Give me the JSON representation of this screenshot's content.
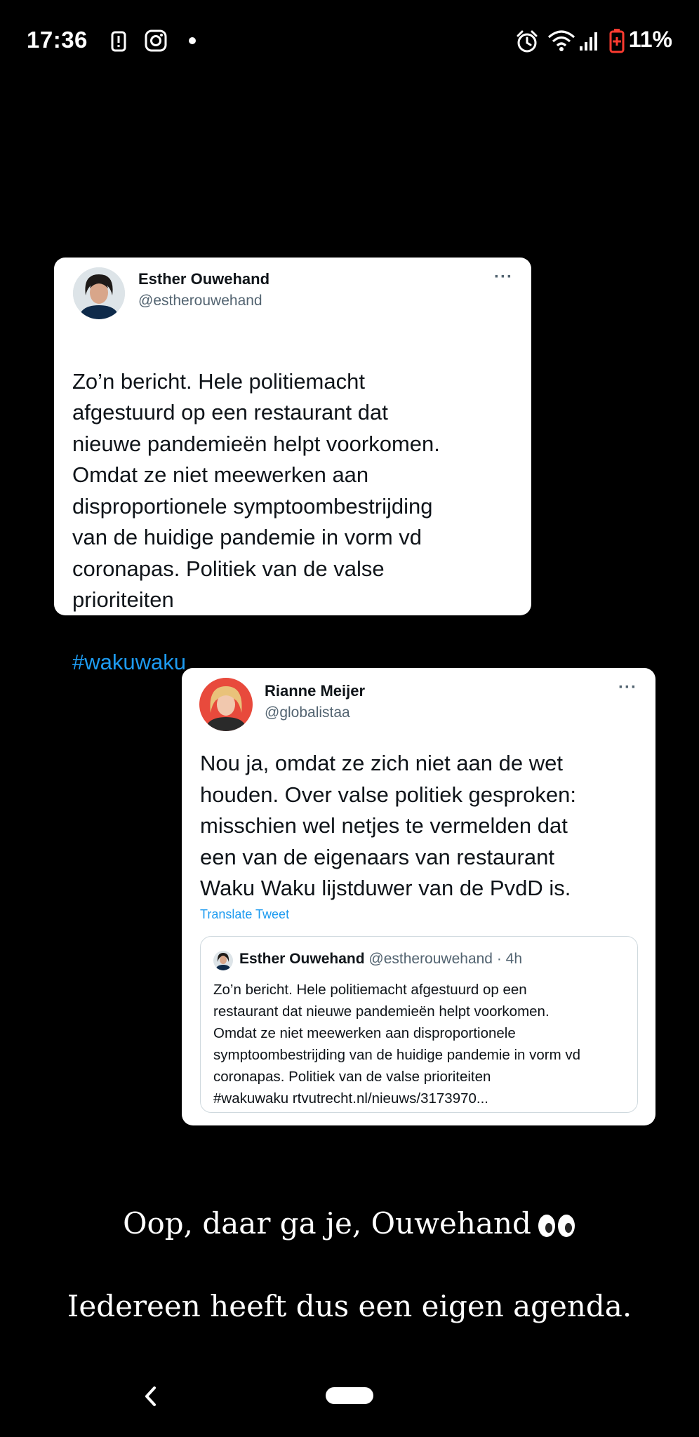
{
  "status_bar": {
    "time": "17:36",
    "battery": "11%",
    "icons": [
      "alert-icon",
      "instagram-icon",
      "dot-icon",
      "alarm-icon",
      "wifi-icon",
      "signal-icon",
      "battery-icon"
    ]
  },
  "tweet1": {
    "name": "Esther Ouwehand",
    "handle": "@estherouwehand",
    "more": "···",
    "text": "Zo’n bericht. Hele politiemacht\nafgestuurd op een restaurant dat\nnieuwe pandemieën helpt voorkomen.\nOmdat ze niet meewerken aan\ndisproportionele symptoombestrijding\nvan de huidige pandemie in vorm vd\ncoronapas. Politiek van de valse\nprioriteiten",
    "hashtag": "#wakuwaku"
  },
  "tweet2": {
    "name": "Rianne Meijer",
    "handle": "@globalistaa",
    "more": "···",
    "text": "Nou ja, omdat ze zich niet aan de wet\nhouden. Over valse politiek gesproken:\nmisschien wel netjes te vermelden dat\neen van de eigenaars van restaurant\nWaku Waku lijstduwer van de PvdD is.",
    "translate": "Translate Tweet",
    "quote": {
      "name": "Esther Ouwehand",
      "meta": "@estherouwehand · 4h",
      "text": "Zo’n bericht. Hele politiemacht afgestuurd op een\nrestaurant dat nieuwe pandemieën helpt voorkomen.\nOmdat ze niet meewerken aan disproportionele\nsymptoombestrijding van de huidige pandemie in vorm vd\ncoronapas. Politiek van de valse prioriteiten\n#wakuwaku  rtvutrecht.nl/nieuws/3173970..."
    }
  },
  "caption": {
    "line1": "Oop, daar ga je, Ouwehand",
    "line2": "Iedereen heeft dus een eigen agenda.",
    "emoji": "eyes-icon"
  },
  "nav": {
    "icons": [
      "back-icon",
      "home-pill"
    ]
  },
  "colors": {
    "background": "#000000",
    "card": "#ffffff",
    "link": "#1d9bf0",
    "secondary_text": "#536471"
  }
}
